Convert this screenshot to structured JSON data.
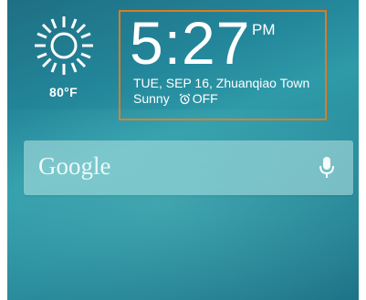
{
  "weather": {
    "condition_icon": "sun-icon",
    "temperature": "80°F"
  },
  "clock": {
    "time": "5:27",
    "ampm": "PM",
    "date_location": "TUE, SEP 16, Zhuanqiao Town",
    "condition": "Sunny",
    "alarm_icon": "alarm-clock-icon",
    "alarm_status": "OFF"
  },
  "search": {
    "brand": "Google",
    "mic_icon": "microphone-icon"
  },
  "colors": {
    "highlight_border": "#e07a1f",
    "wallpaper": "#2a8f9f",
    "text": "#ffffff"
  }
}
